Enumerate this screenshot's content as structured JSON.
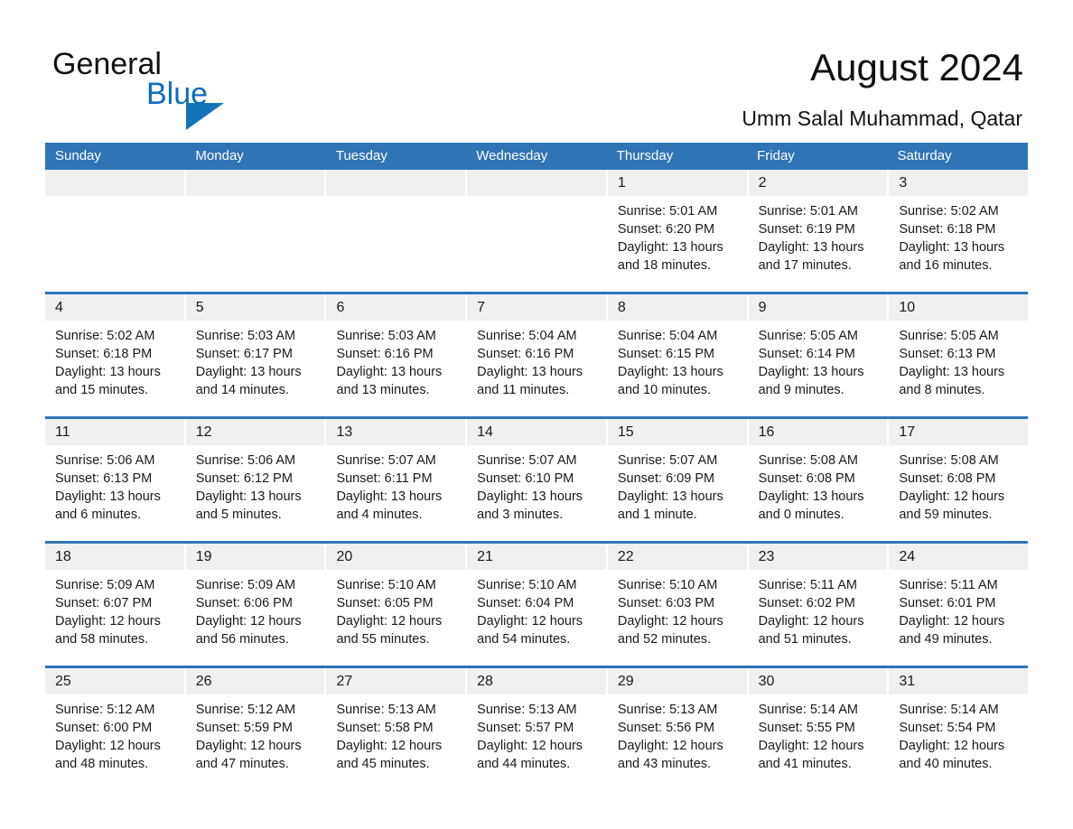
{
  "brand": {
    "name_part1": "General",
    "name_part2": "Blue",
    "triangle_color": "#1573b8",
    "blue_color": "#0b6cbf"
  },
  "header": {
    "title": "August 2024",
    "subtitle": "Umm Salal Muhammad, Qatar",
    "accent_color": "#2f75b5",
    "day_band_color": "#f0f0f0"
  },
  "weekdays": [
    "Sunday",
    "Monday",
    "Tuesday",
    "Wednesday",
    "Thursday",
    "Friday",
    "Saturday"
  ],
  "weeks": [
    [
      {
        "day": "",
        "empty": true,
        "l1": "",
        "l2": "",
        "l3": "",
        "l4": ""
      },
      {
        "day": "",
        "empty": true,
        "l1": "",
        "l2": "",
        "l3": "",
        "l4": ""
      },
      {
        "day": "",
        "empty": true,
        "l1": "",
        "l2": "",
        "l3": "",
        "l4": ""
      },
      {
        "day": "",
        "empty": true,
        "l1": "",
        "l2": "",
        "l3": "",
        "l4": ""
      },
      {
        "day": "1",
        "empty": false,
        "l1": "Sunrise: 5:01 AM",
        "l2": "Sunset: 6:20 PM",
        "l3": "Daylight: 13 hours",
        "l4": "and 18 minutes."
      },
      {
        "day": "2",
        "empty": false,
        "l1": "Sunrise: 5:01 AM",
        "l2": "Sunset: 6:19 PM",
        "l3": "Daylight: 13 hours",
        "l4": "and 17 minutes."
      },
      {
        "day": "3",
        "empty": false,
        "l1": "Sunrise: 5:02 AM",
        "l2": "Sunset: 6:18 PM",
        "l3": "Daylight: 13 hours",
        "l4": "and 16 minutes."
      }
    ],
    [
      {
        "day": "4",
        "empty": false,
        "l1": "Sunrise: 5:02 AM",
        "l2": "Sunset: 6:18 PM",
        "l3": "Daylight: 13 hours",
        "l4": "and 15 minutes."
      },
      {
        "day": "5",
        "empty": false,
        "l1": "Sunrise: 5:03 AM",
        "l2": "Sunset: 6:17 PM",
        "l3": "Daylight: 13 hours",
        "l4": "and 14 minutes."
      },
      {
        "day": "6",
        "empty": false,
        "l1": "Sunrise: 5:03 AM",
        "l2": "Sunset: 6:16 PM",
        "l3": "Daylight: 13 hours",
        "l4": "and 13 minutes."
      },
      {
        "day": "7",
        "empty": false,
        "l1": "Sunrise: 5:04 AM",
        "l2": "Sunset: 6:16 PM",
        "l3": "Daylight: 13 hours",
        "l4": "and 11 minutes."
      },
      {
        "day": "8",
        "empty": false,
        "l1": "Sunrise: 5:04 AM",
        "l2": "Sunset: 6:15 PM",
        "l3": "Daylight: 13 hours",
        "l4": "and 10 minutes."
      },
      {
        "day": "9",
        "empty": false,
        "l1": "Sunrise: 5:05 AM",
        "l2": "Sunset: 6:14 PM",
        "l3": "Daylight: 13 hours",
        "l4": "and 9 minutes."
      },
      {
        "day": "10",
        "empty": false,
        "l1": "Sunrise: 5:05 AM",
        "l2": "Sunset: 6:13 PM",
        "l3": "Daylight: 13 hours",
        "l4": "and 8 minutes."
      }
    ],
    [
      {
        "day": "11",
        "empty": false,
        "l1": "Sunrise: 5:06 AM",
        "l2": "Sunset: 6:13 PM",
        "l3": "Daylight: 13 hours",
        "l4": "and 6 minutes."
      },
      {
        "day": "12",
        "empty": false,
        "l1": "Sunrise: 5:06 AM",
        "l2": "Sunset: 6:12 PM",
        "l3": "Daylight: 13 hours",
        "l4": "and 5 minutes."
      },
      {
        "day": "13",
        "empty": false,
        "l1": "Sunrise: 5:07 AM",
        "l2": "Sunset: 6:11 PM",
        "l3": "Daylight: 13 hours",
        "l4": "and 4 minutes."
      },
      {
        "day": "14",
        "empty": false,
        "l1": "Sunrise: 5:07 AM",
        "l2": "Sunset: 6:10 PM",
        "l3": "Daylight: 13 hours",
        "l4": "and 3 minutes."
      },
      {
        "day": "15",
        "empty": false,
        "l1": "Sunrise: 5:07 AM",
        "l2": "Sunset: 6:09 PM",
        "l3": "Daylight: 13 hours",
        "l4": "and 1 minute."
      },
      {
        "day": "16",
        "empty": false,
        "l1": "Sunrise: 5:08 AM",
        "l2": "Sunset: 6:08 PM",
        "l3": "Daylight: 13 hours",
        "l4": "and 0 minutes."
      },
      {
        "day": "17",
        "empty": false,
        "l1": "Sunrise: 5:08 AM",
        "l2": "Sunset: 6:08 PM",
        "l3": "Daylight: 12 hours",
        "l4": "and 59 minutes."
      }
    ],
    [
      {
        "day": "18",
        "empty": false,
        "l1": "Sunrise: 5:09 AM",
        "l2": "Sunset: 6:07 PM",
        "l3": "Daylight: 12 hours",
        "l4": "and 58 minutes."
      },
      {
        "day": "19",
        "empty": false,
        "l1": "Sunrise: 5:09 AM",
        "l2": "Sunset: 6:06 PM",
        "l3": "Daylight: 12 hours",
        "l4": "and 56 minutes."
      },
      {
        "day": "20",
        "empty": false,
        "l1": "Sunrise: 5:10 AM",
        "l2": "Sunset: 6:05 PM",
        "l3": "Daylight: 12 hours",
        "l4": "and 55 minutes."
      },
      {
        "day": "21",
        "empty": false,
        "l1": "Sunrise: 5:10 AM",
        "l2": "Sunset: 6:04 PM",
        "l3": "Daylight: 12 hours",
        "l4": "and 54 minutes."
      },
      {
        "day": "22",
        "empty": false,
        "l1": "Sunrise: 5:10 AM",
        "l2": "Sunset: 6:03 PM",
        "l3": "Daylight: 12 hours",
        "l4": "and 52 minutes."
      },
      {
        "day": "23",
        "empty": false,
        "l1": "Sunrise: 5:11 AM",
        "l2": "Sunset: 6:02 PM",
        "l3": "Daylight: 12 hours",
        "l4": "and 51 minutes."
      },
      {
        "day": "24",
        "empty": false,
        "l1": "Sunrise: 5:11 AM",
        "l2": "Sunset: 6:01 PM",
        "l3": "Daylight: 12 hours",
        "l4": "and 49 minutes."
      }
    ],
    [
      {
        "day": "25",
        "empty": false,
        "l1": "Sunrise: 5:12 AM",
        "l2": "Sunset: 6:00 PM",
        "l3": "Daylight: 12 hours",
        "l4": "and 48 minutes."
      },
      {
        "day": "26",
        "empty": false,
        "l1": "Sunrise: 5:12 AM",
        "l2": "Sunset: 5:59 PM",
        "l3": "Daylight: 12 hours",
        "l4": "and 47 minutes."
      },
      {
        "day": "27",
        "empty": false,
        "l1": "Sunrise: 5:13 AM",
        "l2": "Sunset: 5:58 PM",
        "l3": "Daylight: 12 hours",
        "l4": "and 45 minutes."
      },
      {
        "day": "28",
        "empty": false,
        "l1": "Sunrise: 5:13 AM",
        "l2": "Sunset: 5:57 PM",
        "l3": "Daylight: 12 hours",
        "l4": "and 44 minutes."
      },
      {
        "day": "29",
        "empty": false,
        "l1": "Sunrise: 5:13 AM",
        "l2": "Sunset: 5:56 PM",
        "l3": "Daylight: 12 hours",
        "l4": "and 43 minutes."
      },
      {
        "day": "30",
        "empty": false,
        "l1": "Sunrise: 5:14 AM",
        "l2": "Sunset: 5:55 PM",
        "l3": "Daylight: 12 hours",
        "l4": "and 41 minutes."
      },
      {
        "day": "31",
        "empty": false,
        "l1": "Sunrise: 5:14 AM",
        "l2": "Sunset: 5:54 PM",
        "l3": "Daylight: 12 hours",
        "l4": "and 40 minutes."
      }
    ]
  ]
}
